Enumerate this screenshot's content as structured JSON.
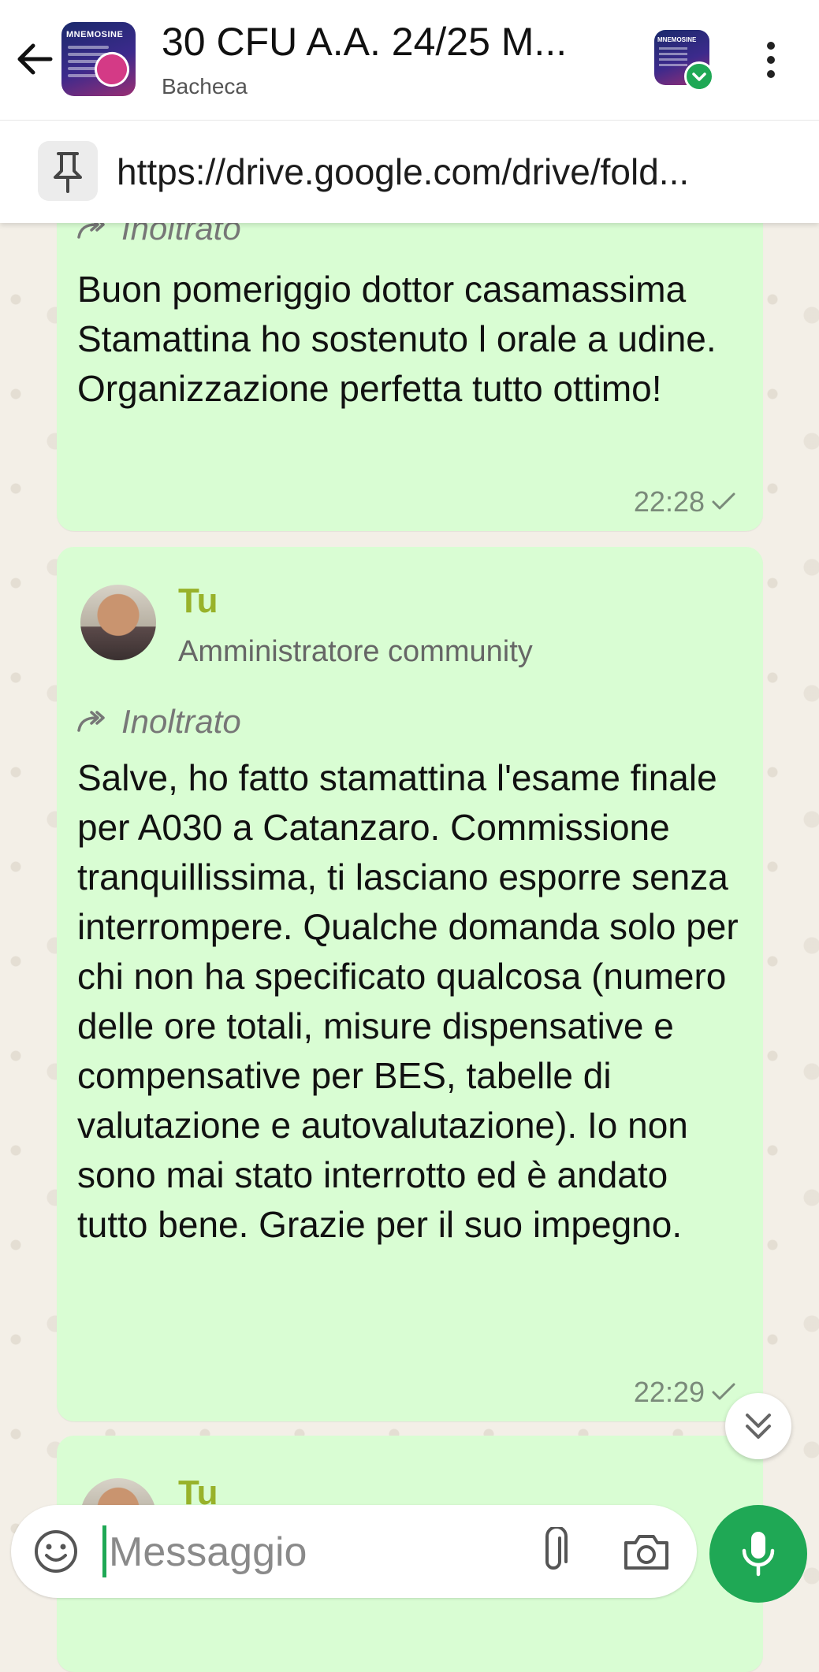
{
  "header": {
    "title": "30 CFU A.A. 24/25 M...",
    "subtitle": "Bacheca",
    "group_avatar_text": "MNEMOSINE",
    "community_avatar_text": "MNEMOSINE",
    "icons": {
      "back": "arrow-left-icon",
      "more": "more-vertical-icon",
      "verified": "check-badge-icon"
    }
  },
  "pinned": {
    "text": "https://drive.google.com/drive/fold...",
    "icon": "pin-icon"
  },
  "messages": [
    {
      "forwarded_label": "Inoltrato",
      "text": "Buon pomeriggio dottor casamassima Stamattina ho sostenuto l orale a udine. Organizzazione perfetta tutto ottimo!",
      "time": "22:28"
    },
    {
      "sender": "Tu",
      "role": "Amministratore community",
      "forwarded_label": "Inoltrato",
      "text": "Salve, ho fatto stamattina l'esame finale per A030 a Catanzaro. Commissione tranquillissima, ti lasciano esporre senza interrompere. Qualche domanda solo per chi non ha specificato qualcosa (numero delle ore totali, misure dispensative e compensative per BES, tabelle di valutazione e autovalutazione). Io non sono mai stato interrotto ed è andato tutto bene. Grazie per il suo impegno.",
      "time": "22:29"
    },
    {
      "sender": "Tu"
    }
  ],
  "composer": {
    "placeholder": "Messaggio",
    "icons": {
      "emoji": "emoji-icon",
      "attach": "paperclip-icon",
      "camera": "camera-icon",
      "mic": "microphone-icon"
    }
  },
  "colors": {
    "bubble": "#d9fdd3",
    "accent_green": "#1fa855",
    "sender_name": "#98b22a",
    "wallpaper": "#f3efe7"
  }
}
